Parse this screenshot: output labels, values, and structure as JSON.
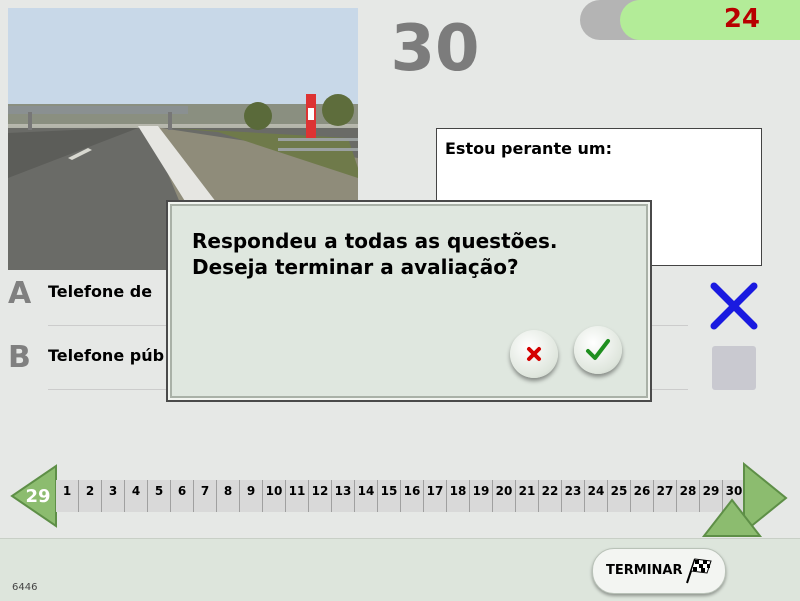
{
  "question": {
    "number": "30",
    "prompt": "Estou perante um:",
    "answers": [
      {
        "letter": "A",
        "text": "Telefone de"
      },
      {
        "letter": "B",
        "text": "Telefone púb"
      }
    ]
  },
  "timer": {
    "value": "24"
  },
  "dialog": {
    "line1": "Respondeu a todas as questões.",
    "line2": "Deseja terminar a avaliação?"
  },
  "timeline": {
    "current": "29",
    "cells": [
      "1",
      "2",
      "3",
      "4",
      "5",
      "6",
      "7",
      "8",
      "9",
      "10",
      "11",
      "12",
      "13",
      "14",
      "15",
      "16",
      "17",
      "18",
      "19",
      "20",
      "21",
      "22",
      "23",
      "24",
      "25",
      "26",
      "27",
      "28",
      "29",
      "30"
    ]
  },
  "footer": {
    "finish_label": "TERMINAR",
    "code": "6446"
  },
  "colors": {
    "timer_text": "#b80000",
    "timer_bg": "#b3ec98",
    "wrong_mark": "#1a1ae0",
    "nav_green": "#8cbc6f"
  },
  "icons": {
    "wrong": "x-mark-icon",
    "cancel": "red-x-icon",
    "confirm": "green-check-icon",
    "finish": "checkered-flag-icon"
  }
}
